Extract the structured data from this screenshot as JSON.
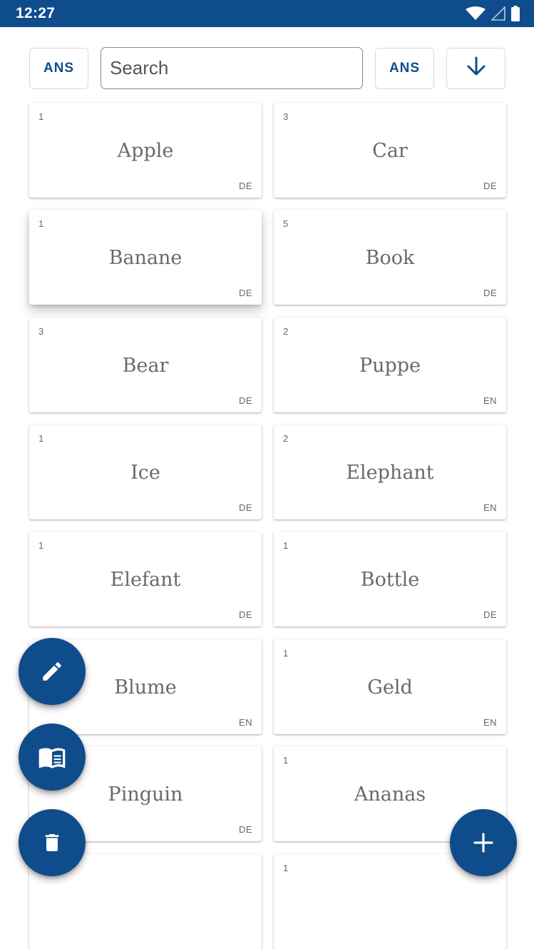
{
  "status_bar": {
    "time": "12:27",
    "icons": [
      "wifi-icon",
      "signal-icon",
      "battery-icon"
    ],
    "background_color": "#0f4c8c"
  },
  "toolbar": {
    "left_button_label": "ANS",
    "search_placeholder": "Search",
    "right_button_label": "ANS",
    "sort_icon": "arrow-down-icon"
  },
  "cards": [
    {
      "count": "1",
      "word": "Apple",
      "lang": "DE"
    },
    {
      "count": "3",
      "word": "Car",
      "lang": "DE"
    },
    {
      "count": "1",
      "word": "Banane",
      "lang": "DE"
    },
    {
      "count": "5",
      "word": "Book",
      "lang": "DE"
    },
    {
      "count": "3",
      "word": "Bear",
      "lang": "DE"
    },
    {
      "count": "2",
      "word": "Puppe",
      "lang": "EN"
    },
    {
      "count": "1",
      "word": "Ice",
      "lang": "DE"
    },
    {
      "count": "2",
      "word": "Elephant",
      "lang": "EN"
    },
    {
      "count": "1",
      "word": "Elefant",
      "lang": "DE"
    },
    {
      "count": "1",
      "word": "Bottle",
      "lang": "DE"
    },
    {
      "count": "",
      "word": "Blume",
      "lang": "EN"
    },
    {
      "count": "1",
      "word": "Geld",
      "lang": "EN"
    },
    {
      "count": "",
      "word": "Pinguin",
      "lang": "DE"
    },
    {
      "count": "1",
      "word": "Ananas",
      "lang": ""
    },
    {
      "count": "",
      "word": "",
      "lang": ""
    },
    {
      "count": "1",
      "word": "",
      "lang": ""
    }
  ],
  "fabs": {
    "edit_icon": "pencil-icon",
    "read_icon": "book-icon",
    "delete_icon": "trash-icon",
    "add_icon": "plus-icon"
  },
  "colors": {
    "accent": "#0f4c8c",
    "card_text": "#6a6a6a"
  }
}
